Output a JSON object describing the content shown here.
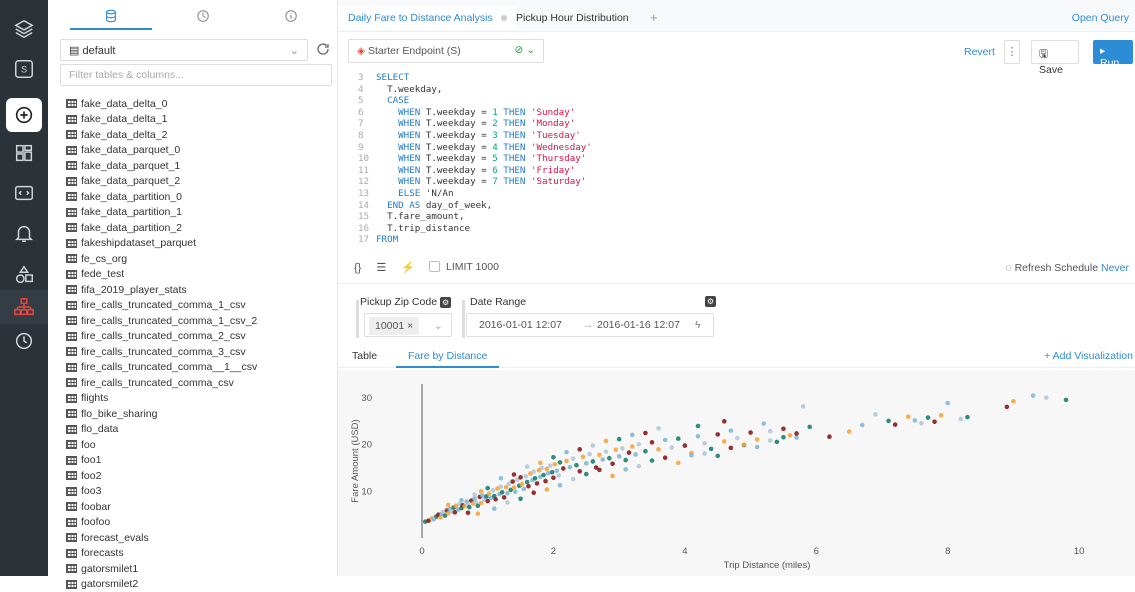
{
  "nav": {
    "items": [
      "layers-icon",
      "s-icon",
      "plus-circle-icon",
      "dashboard-icon",
      "code-icon",
      "bell-icon",
      "shapes-icon",
      "sitemap-icon",
      "clock-icon"
    ]
  },
  "sidebar": {
    "database": "default",
    "filter_placeholder": "Filter tables & columns...",
    "tables": [
      "fake_data_delta_0",
      "fake_data_delta_1",
      "fake_data_delta_2",
      "fake_data_parquet_0",
      "fake_data_parquet_1",
      "fake_data_parquet_2",
      "fake_data_partition_0",
      "fake_data_partition_1",
      "fake_data_partition_2",
      "fakeshipdataset_parquet",
      "fe_cs_org",
      "fede_test",
      "fifa_2019_player_stats",
      "fire_calls_truncated_comma_1_csv",
      "fire_calls_truncated_comma_1_csv_2",
      "fire_calls_truncated_comma_2_csv",
      "fire_calls_truncated_comma_3_csv",
      "fire_calls_truncated_comma__1__csv",
      "fire_calls_truncated_comma_csv",
      "flights",
      "flo_bike_sharing",
      "flo_data",
      "foo",
      "foo1",
      "foo2",
      "foo3",
      "foobar",
      "foofoo",
      "forecast_evals",
      "forecasts",
      "gatorsmilet1",
      "gatorsmilet2"
    ]
  },
  "tabs": {
    "tab1": "Daily Fare to Distance Analysis",
    "tab2": "Pickup Hour Distribution",
    "add": "+",
    "open_query": "Open Query"
  },
  "toolbar": {
    "endpoint": "Starter Endpoint (S)",
    "revert": "Revert",
    "kebab": "⋮",
    "save": "Save",
    "run": "▸ Run"
  },
  "code": [
    {
      "n": "3",
      "html": "<span class='kw'>SELECT</span>"
    },
    {
      "n": "4",
      "html": "  T.weekday,"
    },
    {
      "n": "5",
      "html": "  <span class='kw'>CASE</span>"
    },
    {
      "n": "6",
      "html": "    <span class='kw'>WHEN</span> T.weekday = <span class='num'>1</span> <span class='kw'>THEN</span> <span class='str'>'Sunday'</span>"
    },
    {
      "n": "7",
      "html": "    <span class='kw'>WHEN</span> T.weekday = <span class='num'>2</span> <span class='kw'>THEN</span> <span class='str'>'Monday'</span>"
    },
    {
      "n": "8",
      "html": "    <span class='kw'>WHEN</span> T.weekday = <span class='num'>3</span> <span class='kw'>THEN</span> <span class='str'>'Tuesday'</span>"
    },
    {
      "n": "9",
      "html": "    <span class='kw'>WHEN</span> T.weekday = <span class='num'>4</span> <span class='kw'>THEN</span> <span class='str'>'Wednesday'</span>"
    },
    {
      "n": "10",
      "html": "    <span class='kw'>WHEN</span> T.weekday = <span class='num'>5</span> <span class='kw'>THEN</span> <span class='str'>'Thursday'</span>"
    },
    {
      "n": "11",
      "html": "    <span class='kw'>WHEN</span> T.weekday = <span class='num'>6</span> <span class='kw'>THEN</span> <span class='str'>'Friday'</span>"
    },
    {
      "n": "12",
      "html": "    <span class='kw'>WHEN</span> T.weekday = <span class='num'>7</span> <span class='kw'>THEN</span> <span class='str'>'Saturday'</span>"
    },
    {
      "n": "13",
      "html": "    <span class='kw'>ELSE</span> 'N/An"
    },
    {
      "n": "14",
      "html": "  <span class='kw'>END AS</span> day_of_week,"
    },
    {
      "n": "15",
      "html": "  T.fare_amount,"
    },
    {
      "n": "16",
      "html": "  T.trip_distance"
    },
    {
      "n": "17",
      "html": "<span class='kw'>FROM</span>"
    }
  ],
  "editor_tools": {
    "format": "{}",
    "limit": "LIMIT 1000",
    "refresh_schedule": "Refresh Schedule",
    "refresh_value": "Never"
  },
  "params": {
    "pickup_zip_label": "Pickup Zip Code",
    "pickup_zip_value": "10001 ×",
    "date_range_label": "Date Range",
    "date_start": "2016-01-01 12:07",
    "date_sep": "→",
    "date_end": "2016-01-16 12:07"
  },
  "viz_tabs": {
    "table": "Table",
    "fare": "Fare by Distance",
    "add": "+ Add Visualization"
  },
  "colors": {
    "accent": "#2d8cd6",
    "nav_bg": "#2b3238",
    "run": "#2d8cd6",
    "points": [
      "#1a7f6e",
      "#8b1a1a",
      "#f4a53c",
      "#7fb9d6",
      "#b3c7d9"
    ]
  },
  "chart_data": {
    "type": "scatter",
    "xlabel": "Trip Distance (miles)",
    "ylabel": "Fare Amount (USD)",
    "xlim": [
      0,
      10.5
    ],
    "ylim": [
      0,
      33
    ],
    "xticks": [
      0,
      2,
      4,
      6,
      8,
      10
    ],
    "yticks": [
      10,
      20,
      30
    ],
    "grid": false,
    "points": [
      [
        0.05,
        3.5
      ],
      [
        0.1,
        3.7
      ],
      [
        0.15,
        4.2
      ],
      [
        0.18,
        4.0
      ],
      [
        0.2,
        4.5
      ],
      [
        0.22,
        4.6
      ],
      [
        0.25,
        5.0
      ],
      [
        0.28,
        4.4
      ],
      [
        0.3,
        5.2
      ],
      [
        0.32,
        5.6
      ],
      [
        0.35,
        4.8
      ],
      [
        0.38,
        5.9
      ],
      [
        0.4,
        5.3
      ],
      [
        0.42,
        6.2
      ],
      [
        0.45,
        5.7
      ],
      [
        0.48,
        6.5
      ],
      [
        0.5,
        5.5
      ],
      [
        0.52,
        6.9
      ],
      [
        0.55,
        6.1
      ],
      [
        0.58,
        7.3
      ],
      [
        0.6,
        6.4
      ],
      [
        0.62,
        7.0
      ],
      [
        0.65,
        6.8
      ],
      [
        0.68,
        7.8
      ],
      [
        0.7,
        7.1
      ],
      [
        0.72,
        6.6
      ],
      [
        0.75,
        8.0
      ],
      [
        0.78,
        7.4
      ],
      [
        0.8,
        8.5
      ],
      [
        0.82,
        7.7
      ],
      [
        0.85,
        6.9
      ],
      [
        0.88,
        8.8
      ],
      [
        0.9,
        7.5
      ],
      [
        0.92,
        9.1
      ],
      [
        0.95,
        8.2
      ],
      [
        0.98,
        8.9
      ],
      [
        1.0,
        7.9
      ],
      [
        1.02,
        9.5
      ],
      [
        1.05,
        8.6
      ],
      [
        1.08,
        10.2
      ],
      [
        1.1,
        9.0
      ],
      [
        1.12,
        8.3
      ],
      [
        1.15,
        10.6
      ],
      [
        1.18,
        9.4
      ],
      [
        1.2,
        11.0
      ],
      [
        1.22,
        9.8
      ],
      [
        1.25,
        8.7
      ],
      [
        1.28,
        10.9
      ],
      [
        1.3,
        9.6
      ],
      [
        1.32,
        11.6
      ],
      [
        1.35,
        10.3
      ],
      [
        1.38,
        12.1
      ],
      [
        1.4,
        10.8
      ],
      [
        1.42,
        9.9
      ],
      [
        1.45,
        12.5
      ],
      [
        1.48,
        11.2
      ],
      [
        1.5,
        13.0
      ],
      [
        1.52,
        11.5
      ],
      [
        1.55,
        10.5
      ],
      [
        1.58,
        13.2
      ],
      [
        1.6,
        12.0
      ],
      [
        1.62,
        11.1
      ],
      [
        1.65,
        13.8
      ],
      [
        1.68,
        12.4
      ],
      [
        1.7,
        14.2
      ],
      [
        1.72,
        12.8
      ],
      [
        1.75,
        11.7
      ],
      [
        1.78,
        14.5
      ],
      [
        1.8,
        13.1
      ],
      [
        1.82,
        15.0
      ],
      [
        1.85,
        13.5
      ],
      [
        1.88,
        12.2
      ],
      [
        1.9,
        14.8
      ],
      [
        1.92,
        13.9
      ],
      [
        1.95,
        15.5
      ],
      [
        1.98,
        14.1
      ],
      [
        2.0,
        12.9
      ],
      [
        2.02,
        15.8
      ],
      [
        2.05,
        14.4
      ],
      [
        2.08,
        13.4
      ],
      [
        2.1,
        16.2
      ],
      [
        2.15,
        14.9
      ],
      [
        2.2,
        16.5
      ],
      [
        2.25,
        15.2
      ],
      [
        2.3,
        17.0
      ],
      [
        2.35,
        15.6
      ],
      [
        2.4,
        14.3
      ],
      [
        2.45,
        17.4
      ],
      [
        2.5,
        16.0
      ],
      [
        2.55,
        18.0
      ],
      [
        2.6,
        16.4
      ],
      [
        2.65,
        15.1
      ],
      [
        2.7,
        17.8
      ],
      [
        2.75,
        16.8
      ],
      [
        2.8,
        18.5
      ],
      [
        2.85,
        17.1
      ],
      [
        2.9,
        15.9
      ],
      [
        2.95,
        18.9
      ],
      [
        3.0,
        17.5
      ],
      [
        3.05,
        19.2
      ],
      [
        3.1,
        16.7
      ],
      [
        3.15,
        18.3
      ],
      [
        3.2,
        19.6
      ],
      [
        3.25,
        17.9
      ],
      [
        3.3,
        20.1
      ],
      [
        3.4,
        18.6
      ],
      [
        3.5,
        20.5
      ],
      [
        3.6,
        19.0
      ],
      [
        3.7,
        21.0
      ],
      [
        3.8,
        19.4
      ],
      [
        3.9,
        21.3
      ],
      [
        4.0,
        19.8
      ],
      [
        4.1,
        18.2
      ],
      [
        4.2,
        21.8
      ],
      [
        4.3,
        20.3
      ],
      [
        4.4,
        19.1
      ],
      [
        4.5,
        22.2
      ],
      [
        4.6,
        20.7
      ],
      [
        4.7,
        23.0
      ],
      [
        4.8,
        21.4
      ],
      [
        4.9,
        19.9
      ],
      [
        5.0,
        22.6
      ],
      [
        5.1,
        21.1
      ],
      [
        5.2,
        24.5
      ],
      [
        5.3,
        22.9
      ],
      [
        5.4,
        20.6
      ],
      [
        5.5,
        23.4
      ],
      [
        5.6,
        22.0
      ],
      [
        5.7,
        21.5
      ],
      [
        5.8,
        28.2
      ],
      [
        5.9,
        23.8
      ],
      [
        6.2,
        21.7
      ],
      [
        6.5,
        22.8
      ],
      [
        6.7,
        24.2
      ],
      [
        6.9,
        26.5
      ],
      [
        7.1,
        25.1
      ],
      [
        7.2,
        24.3
      ],
      [
        7.4,
        26.0
      ],
      [
        7.5,
        25.2
      ],
      [
        7.6,
        24.6
      ],
      [
        7.7,
        25.8
      ],
      [
        7.8,
        24.9
      ],
      [
        7.9,
        26.3
      ],
      [
        8.0,
        28.9
      ],
      [
        8.2,
        25.5
      ],
      [
        8.3,
        25.9
      ],
      [
        8.9,
        28.1
      ],
      [
        9.0,
        29.3
      ],
      [
        9.3,
        30.5
      ],
      [
        9.5,
        30.1
      ],
      [
        9.8,
        29.6
      ],
      [
        0.7,
        5.4
      ],
      [
        0.85,
        5.2
      ],
      [
        1.1,
        6.3
      ],
      [
        1.3,
        7.6
      ],
      [
        1.5,
        8.4
      ],
      [
        1.7,
        9.7
      ],
      [
        1.9,
        10.4
      ],
      [
        2.1,
        11.3
      ],
      [
        2.3,
        12.6
      ],
      [
        2.5,
        13.7
      ],
      [
        2.7,
        14.6
      ],
      [
        2.9,
        13.3
      ],
      [
        3.1,
        14.7
      ],
      [
        3.3,
        15.4
      ],
      [
        3.5,
        16.6
      ],
      [
        3.7,
        17.2
      ],
      [
        3.9,
        16.1
      ],
      [
        4.1,
        17.7
      ],
      [
        4.3,
        18.1
      ],
      [
        4.5,
        17.6
      ],
      [
        4.7,
        19.3
      ],
      [
        4.9,
        20.0
      ],
      [
        5.1,
        19.5
      ],
      [
        5.3,
        20.9
      ],
      [
        5.5,
        21.6
      ],
      [
        5.7,
        22.4
      ],
      [
        0.9,
        10.0
      ],
      [
        1.2,
        12.8
      ],
      [
        1.6,
        15.3
      ],
      [
        2.0,
        17.3
      ],
      [
        2.4,
        19.0
      ],
      [
        2.8,
        20.8
      ],
      [
        3.2,
        22.1
      ],
      [
        3.6,
        23.5
      ],
      [
        4.2,
        24.0
      ],
      [
        4.6,
        25.0
      ],
      [
        0.4,
        7.1
      ],
      [
        0.6,
        8.1
      ],
      [
        0.8,
        9.3
      ],
      [
        1.0,
        10.7
      ],
      [
        1.4,
        13.6
      ],
      [
        1.8,
        16.1
      ],
      [
        2.2,
        18.4
      ],
      [
        2.6,
        19.8
      ],
      [
        3.0,
        21.2
      ],
      [
        3.4,
        22.5
      ]
    ]
  }
}
